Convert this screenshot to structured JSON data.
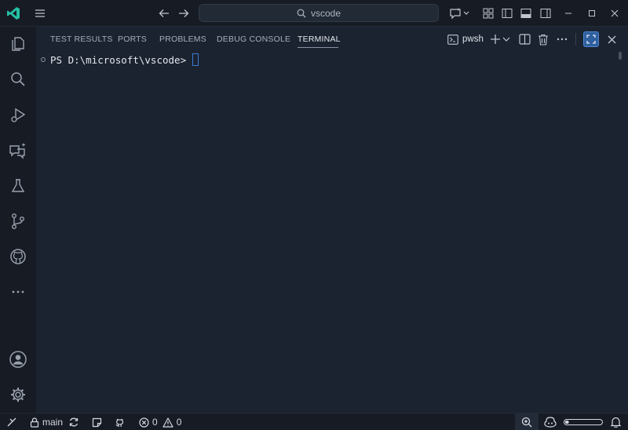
{
  "search": {
    "text": "vscode"
  },
  "panel": {
    "tabs": [
      "TEST RESULTS",
      "PORTS",
      "PROBLEMS",
      "DEBUG CONSOLE",
      "TERMINAL"
    ],
    "active_tab": "TERMINAL",
    "shell_label": "pwsh"
  },
  "terminal": {
    "prompt": "PS D:\\microsoft\\vscode>"
  },
  "statusbar": {
    "branch": "main",
    "errors": "0",
    "warnings": "0",
    "zoom_fraction": 0.1
  },
  "colors": {
    "accent": "#3d7bd8",
    "background": "#1b2330",
    "chrome": "#161b24"
  },
  "icons": [
    "vscode-logo-icon",
    "menu-icon",
    "back-icon",
    "forward-icon",
    "search-icon",
    "copilot-icon",
    "layout-icon",
    "toggle-sidebar-icon",
    "toggle-panel-icon",
    "toggle-secondary-sidebar-icon",
    "minimize-icon",
    "maximize-icon",
    "close-icon",
    "explorer-icon",
    "search-icon",
    "run-debug-icon",
    "chat-icon",
    "testing-icon",
    "source-control-icon",
    "github-icon",
    "more-icon",
    "account-icon",
    "settings-gear-icon"
  ]
}
